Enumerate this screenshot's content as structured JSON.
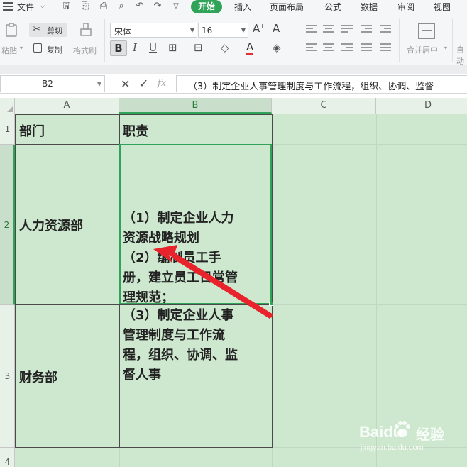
{
  "menubar": {
    "file_label": "文件",
    "tabs": [
      "开始",
      "插入",
      "页面布局",
      "公式",
      "数据",
      "审阅",
      "视图"
    ]
  },
  "ribbon": {
    "paste_label": "粘贴",
    "cut_label": "剪切",
    "copy_label": "复制",
    "format_painter_label": "格式刷",
    "font_name": "宋体",
    "font_size": "16",
    "merge_label": "合并居中",
    "auto_wrap_label": "自动"
  },
  "formula_bar": {
    "name_box": "B2",
    "fx_label": "fx",
    "content": "（3）制定企业人事管理制度与工作流程，组织、协调、监督"
  },
  "sheet": {
    "columns": [
      "A",
      "B",
      "C",
      "D"
    ],
    "rows": [
      "1",
      "2",
      "3",
      "4"
    ],
    "selected_column": "B",
    "selected_row": "2",
    "A1": "部门",
    "B1": "职责",
    "A2": "人力资源部",
    "B2": "（1）制定企业人力\n资源战略规划\n（2）编制员工手\n册，建立员工日常管\n理规范；",
    "A3": "财务部",
    "B3": "（3）制定企业人事\n管理制度与工作流\n程，组织、协调、监\n督人事"
  },
  "watermark": {
    "logo": "Baidu",
    "jingyan": "经验",
    "url": "jingyan.baidu.com"
  },
  "colors": {
    "accent": "#2fa357",
    "cell_bg": "#cde8cf",
    "arrow": "#e8232b"
  }
}
